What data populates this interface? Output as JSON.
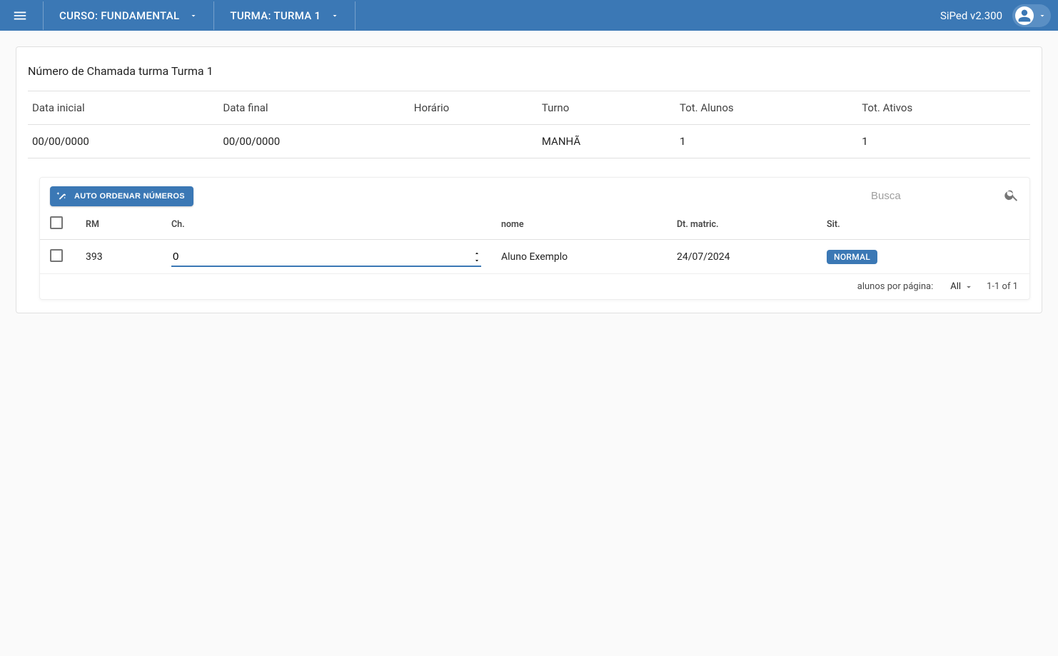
{
  "header": {
    "curso_label": "CURSO: FUNDAMENTAL",
    "turma_label": "TURMA: TURMA 1",
    "version": "SiPed v2.300"
  },
  "page": {
    "title": "Número de Chamada turma Turma 1"
  },
  "info": {
    "headers": {
      "data_inicial": "Data inicial",
      "data_final": "Data final",
      "horario": "Horário",
      "turno": "Turno",
      "tot_alunos": "Tot. Alunos",
      "tot_ativos": "Tot. Ativos"
    },
    "row": {
      "data_inicial": "00/00/0000",
      "data_final": "00/00/0000",
      "horario": "",
      "turno": "MANHÃ",
      "tot_alunos": "1",
      "tot_ativos": "1"
    }
  },
  "toolbar": {
    "auto_order_label": "AUTO ORDENAR NÚMEROS",
    "search_placeholder": "Busca"
  },
  "table": {
    "headers": {
      "rm": "RM",
      "ch": "Ch.",
      "nome": "nome",
      "dt_matric": "Dt. matric.",
      "sit": "Sit."
    },
    "rows": [
      {
        "rm": "393",
        "ch": "0",
        "nome": "Aluno Exemplo",
        "dt_matric": "24/07/2024",
        "sit": "NORMAL"
      }
    ]
  },
  "footer": {
    "rows_per_page_label": "alunos por página:",
    "rows_per_page_value": "All",
    "range_text": "1-1 of 1"
  }
}
